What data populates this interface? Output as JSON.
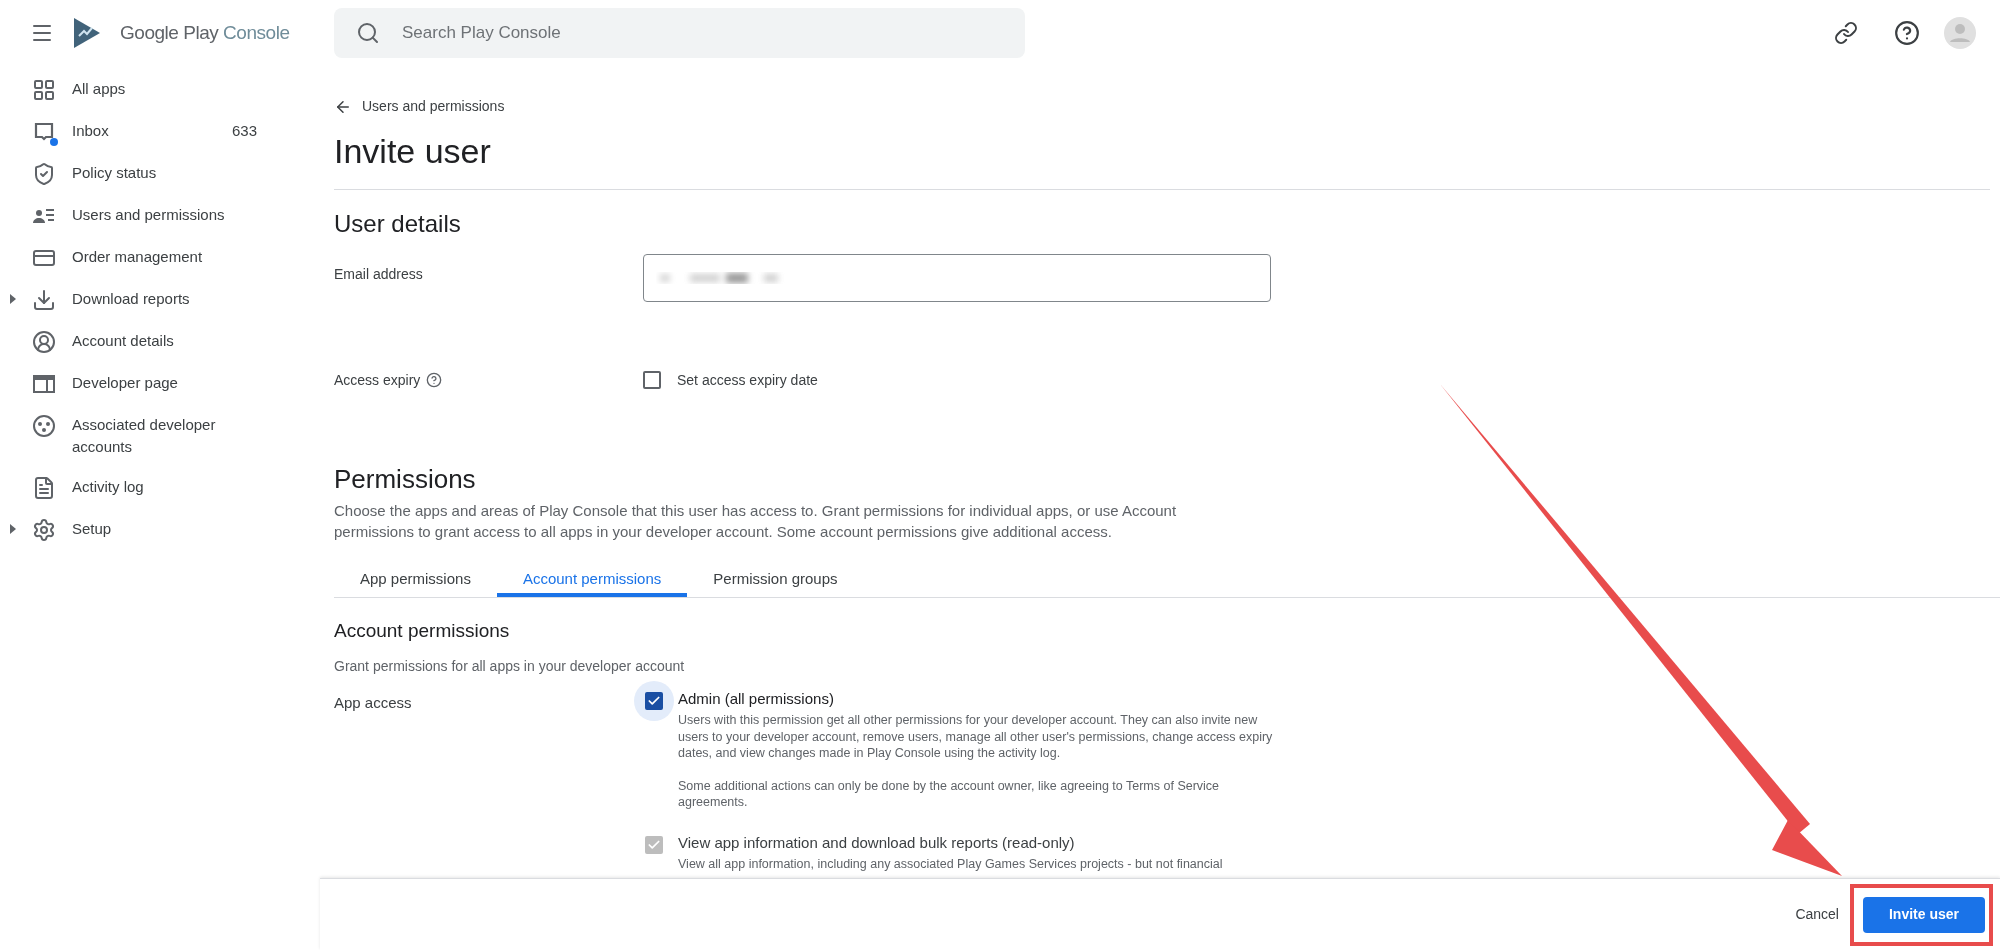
{
  "app": {
    "logo_text": "Google Play",
    "logo_suffix": "Console"
  },
  "search": {
    "placeholder": "Search Play Console"
  },
  "sidebar": {
    "items": [
      {
        "label": "All apps",
        "expandable": false,
        "selected": false
      },
      {
        "label": "Inbox",
        "badge": "633",
        "unread": true,
        "expandable": false,
        "selected": false
      },
      {
        "label": "Policy status",
        "expandable": false,
        "selected": false
      },
      {
        "label": "Users and permissions",
        "expandable": false,
        "selected": false
      },
      {
        "label": "Order management",
        "expandable": false,
        "selected": false
      },
      {
        "label": "Download reports",
        "expandable": true,
        "selected": false
      },
      {
        "label": "Account details",
        "expandable": false,
        "selected": false
      },
      {
        "label": "Developer page",
        "expandable": false,
        "selected": false
      },
      {
        "label": "Associated developer accounts",
        "expandable": false,
        "selected": false
      },
      {
        "label": "Activity log",
        "expandable": false,
        "selected": false
      },
      {
        "label": "Setup",
        "expandable": true,
        "selected": false
      }
    ]
  },
  "breadcrumb": "Users and permissions",
  "title": "Invite user",
  "user_details": {
    "heading": "User details",
    "email_label": "Email address",
    "expiry_label": "Access expiry",
    "expiry_checkbox": {
      "label": "Set access expiry date",
      "checked": false
    }
  },
  "permissions": {
    "heading": "Permissions",
    "description": "Choose the apps and areas of Play Console that this user has access to. Grant permissions for individual apps, or use Account permissions to grant access to all apps in your developer account. Some account permissions give additional access.",
    "tabs": [
      {
        "label": "App permissions",
        "selected": false
      },
      {
        "label": "Account permissions",
        "selected": true
      },
      {
        "label": "Permission groups",
        "selected": false
      }
    ],
    "section_heading": "Account permissions",
    "section_description": "Grant permissions for all apps in your developer account",
    "group_label": "App access",
    "items": [
      {
        "label": "Admin (all permissions)",
        "checked": true,
        "disabled": false,
        "description": [
          "Users with this permission get all other permissions for your developer account. They can also invite new users to your developer account, remove users, manage all other user's permissions, change access expiry dates, and view changes made in Play Console using the activity log.",
          "Some additional actions can only be done by the account owner, like agreeing to Terms of Service agreements."
        ]
      },
      {
        "label": "View app information and download bulk reports (read-only)",
        "checked": true,
        "disabled": true,
        "description": [
          "View all app information, including any associated Play Games Services projects - but not financial"
        ]
      }
    ]
  },
  "footer": {
    "cancel": "Cancel",
    "submit": "Invite user"
  }
}
